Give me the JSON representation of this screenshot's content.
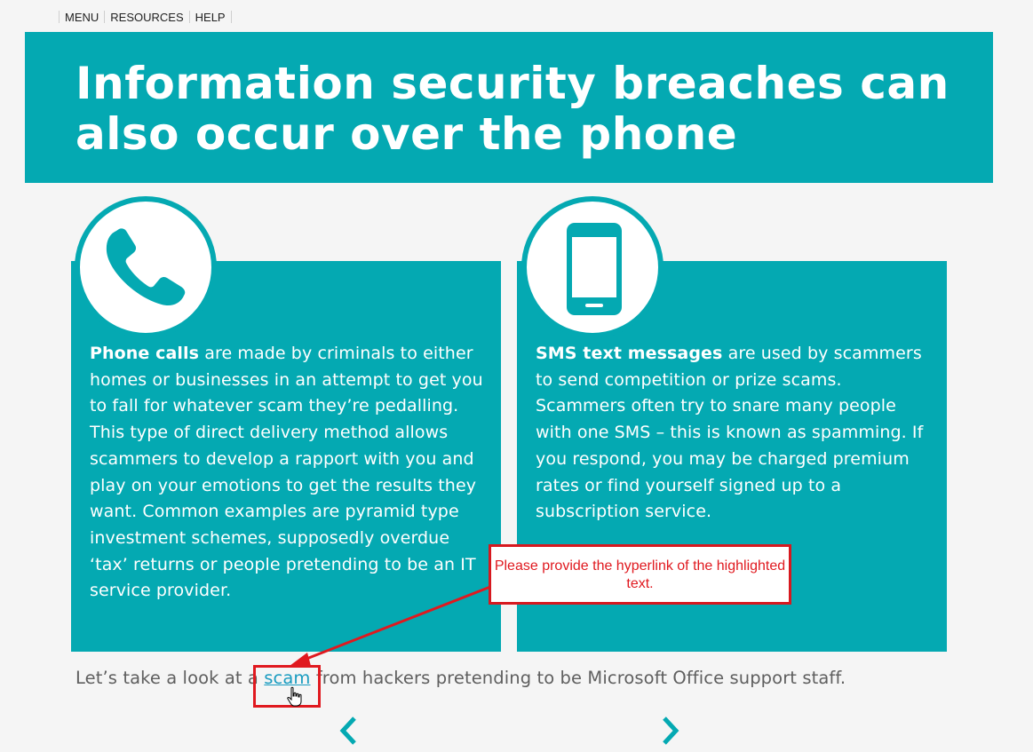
{
  "topnav": {
    "items": [
      "MENU",
      "RESOURCES",
      "HELP"
    ]
  },
  "banner": {
    "title_line1": "Information security breaches can",
    "title_line2": "also occur over the phone"
  },
  "cards": [
    {
      "icon": "phone-icon",
      "bold": "Phone calls",
      "text": " are made by criminals to either homes or businesses in an attempt to get you to fall for whatever scam they’re pedalling. This type of direct delivery method allows scammers to develop a rapport with you and play on your emotions to get the results they want. Common examples are pyramid type investment schemes, supposedly overdue ‘tax’ returns or people pretending to be an IT service provider."
    },
    {
      "icon": "mobile-phone-icon",
      "bold": "SMS text messages",
      "text": " are used by scammers to send competition or prize scams. Scammers often try to snare many people with one SMS – this is known as spamming. If you respond, you may be charged premium rates or find yourself signed up to a subscription service."
    }
  ],
  "bottom": {
    "before": "Let’s take a look at a ",
    "link": "scam",
    "after": " from hackers pretending to be Microsoft Office support staff."
  },
  "annotation": {
    "callout": "Please provide the hyperlink of the highlighted text."
  },
  "colors": {
    "teal": "#04a9b2",
    "annotation_red": "#e0191f",
    "link": "#1a9cc0"
  }
}
